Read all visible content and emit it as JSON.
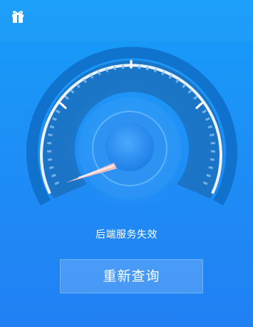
{
  "header": {
    "gift_icon": "gift-icon"
  },
  "gauge": {
    "needle_level": 0.0,
    "colors": {
      "outer_ring": "#0f6fc9",
      "dial_face": "#1b70bd",
      "tick_marks": "#ffffff",
      "needle": "#f5a3a3",
      "hub": "#2c8ff2"
    }
  },
  "status": {
    "text": "后端服务失效"
  },
  "actions": {
    "requery_label": "重新查询"
  },
  "theme": {
    "background_top": "#169df9",
    "background_bottom": "#2180f3"
  }
}
